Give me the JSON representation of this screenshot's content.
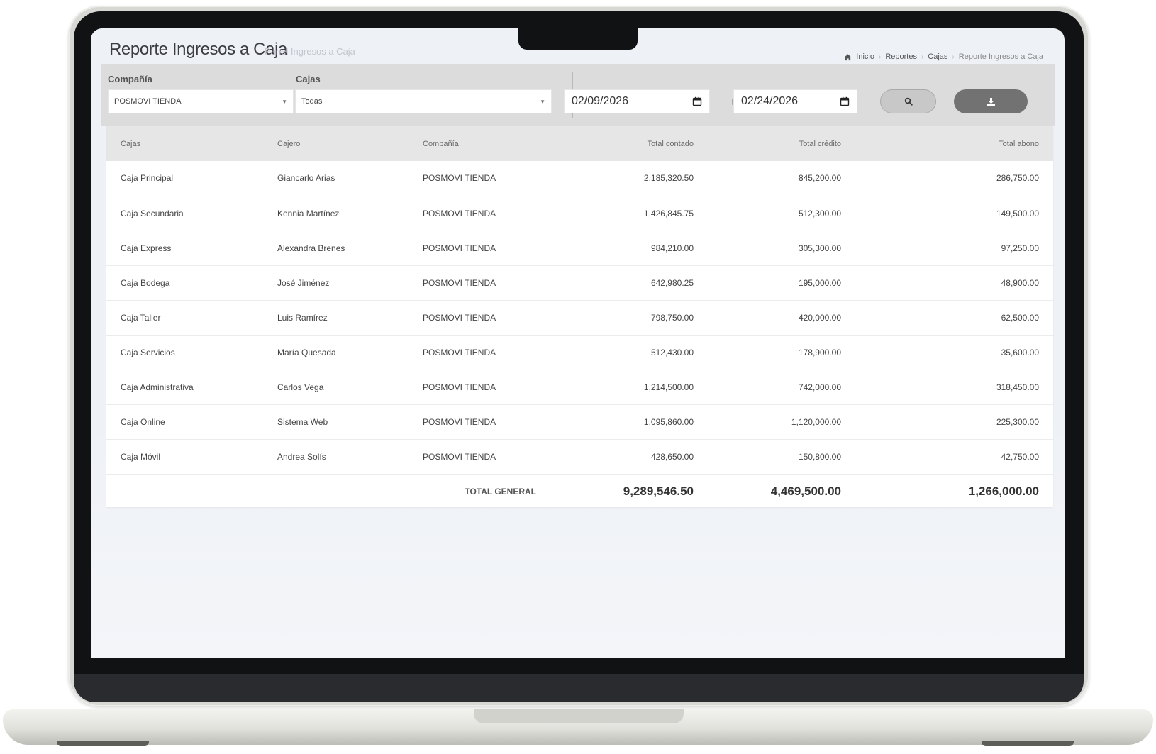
{
  "header": {
    "title": "Reporte Ingresos a Caja",
    "subtitle": "Panel Ingresos a Caja"
  },
  "breadcrumb": {
    "items": [
      "Inicio",
      "Reportes",
      "Cajas"
    ],
    "current": "Reporte Ingresos a Caja"
  },
  "filters": {
    "company_label": "Compañía",
    "company_value": "POSMOVI TIENDA",
    "cajas_label": "Cajas",
    "cajas_value": "Todas",
    "date_from": "02/09/2026",
    "date_to": "02/24/2026"
  },
  "table": {
    "columns": [
      "Cajas",
      "Cajero",
      "Compañía",
      "Total contado",
      "Total crédito",
      "Total abono"
    ],
    "rows": [
      [
        "Caja Principal",
        "Giancarlo Arias",
        "POSMOVI TIENDA",
        "2,185,320.50",
        "845,200.00",
        "286,750.00"
      ],
      [
        "Caja Secundaria",
        "Kennia Martínez",
        "POSMOVI TIENDA",
        "1,426,845.75",
        "512,300.00",
        "149,500.00"
      ],
      [
        "Caja Express",
        "Alexandra Brenes",
        "POSMOVI TIENDA",
        "984,210.00",
        "305,300.00",
        "97,250.00"
      ],
      [
        "Caja Bodega",
        "José Jiménez",
        "POSMOVI TIENDA",
        "642,980.25",
        "195,000.00",
        "48,900.00"
      ],
      [
        "Caja Taller",
        "Luis Ramírez",
        "POSMOVI TIENDA",
        "798,750.00",
        "420,000.00",
        "62,500.00"
      ],
      [
        "Caja Servicios",
        "María Quesada",
        "POSMOVI TIENDA",
        "512,430.00",
        "178,900.00",
        "35,600.00"
      ],
      [
        "Caja Administrativa",
        "Carlos Vega",
        "POSMOVI TIENDA",
        "1,214,500.00",
        "742,000.00",
        "318,450.00"
      ],
      [
        "Caja Online",
        "Sistema Web",
        "POSMOVI TIENDA",
        "1,095,860.00",
        "1,120,000.00",
        "225,300.00"
      ],
      [
        "Caja Móvil",
        "Andrea Solís",
        "POSMOVI TIENDA",
        "428,650.00",
        "150,800.00",
        "42,750.00"
      ]
    ],
    "total_label": "TOTAL GENERAL",
    "total_contado": "9,289,546.50",
    "total_credito": "4,469,500.00",
    "total_abono": "1,266,000.00"
  },
  "icons": {
    "home": "home-icon",
    "calendar": "calendar-icon",
    "search": "search-icon",
    "download": "download-icon"
  }
}
